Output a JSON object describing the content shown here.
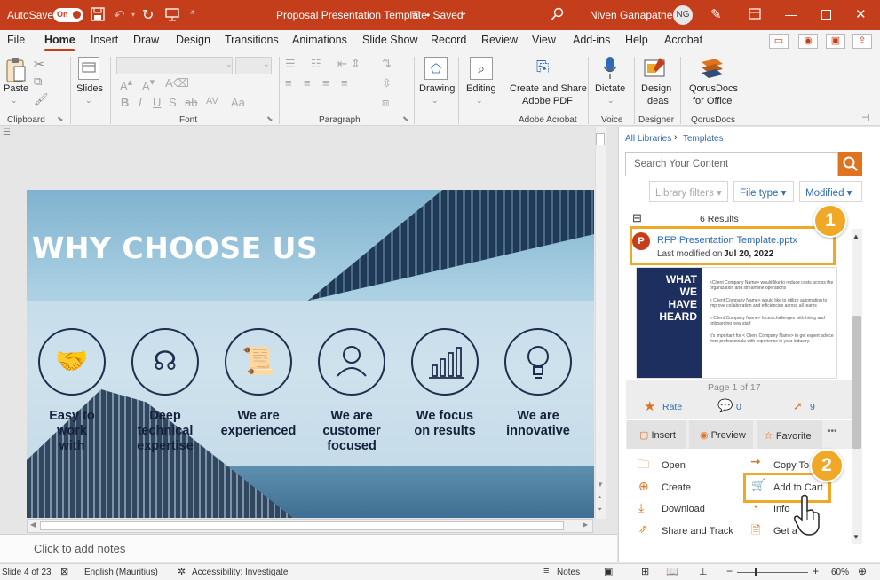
{
  "titlebar": {
    "autosave_label": "AutoSave",
    "autosave_state": "On",
    "document_title": "Proposal Presentation Template",
    "save_status": "• Saved",
    "user_name": "Niven Ganapathee",
    "user_initials": "NG"
  },
  "menu": {
    "tabs": [
      "File",
      "Home",
      "Insert",
      "Draw",
      "Design",
      "Transitions",
      "Animations",
      "Slide Show",
      "Record",
      "Review",
      "View",
      "Add-ins",
      "Help",
      "Acrobat"
    ],
    "active_tab": "Home"
  },
  "ribbon": {
    "paste_label": "Paste",
    "slides_label": "Slides",
    "drawing_label": "Drawing",
    "editing_label": "Editing",
    "create_pdf_line1": "Create and Share",
    "create_pdf_line2": "Adobe PDF",
    "dictate_label": "Dictate",
    "design_ideas_line1": "Design",
    "design_ideas_line2": "Ideas",
    "qorus_line1": "QorusDocs",
    "qorus_line2": "for Office",
    "groups": {
      "clipboard": "Clipboard",
      "font": "Font",
      "paragraph": "Paragraph",
      "adobe": "Adobe Acrobat",
      "voice": "Voice",
      "designer": "Designer",
      "qorus": "QorusDocs"
    }
  },
  "slide": {
    "title": "WHY CHOOSE US",
    "features": [
      {
        "icon": "handshake-icon",
        "line1": "Easy to",
        "line2": "work",
        "line3": "with"
      },
      {
        "icon": "brain-icon",
        "line1": "Deep",
        "line2": "technical",
        "line3": "expertise"
      },
      {
        "icon": "scroll-icon",
        "line1": "We are",
        "line2": "experienced",
        "line3": ""
      },
      {
        "icon": "person-icon",
        "line1": "We are",
        "line2": "customer",
        "line3": "focused"
      },
      {
        "icon": "bar-chart-icon",
        "line1": "We focus",
        "line2": "on results",
        "line3": ""
      },
      {
        "icon": "lightbulb-icon",
        "line1": "We are",
        "line2": "innovative",
        "line3": ""
      }
    ]
  },
  "notes_placeholder": "Click to add notes",
  "status": {
    "slide_info": "Slide 4 of 23",
    "language": "English (Mauritius)",
    "accessibility": "Accessibility: Investigate",
    "notes_label": "Notes",
    "zoom": "60%"
  },
  "pane": {
    "breadcrumb_root": "All Libraries",
    "breadcrumb_sep": "›",
    "breadcrumb_current": "Templates",
    "search_placeholder": "Search Your Content",
    "filters": [
      "Library filters",
      "File type",
      "Modified"
    ],
    "results_count": "6 Results",
    "result": {
      "file_name": "RFP Presentation Template.pptx",
      "modified_prefix": "Last modified on",
      "modified_date": "Jul 20, 2022"
    },
    "thumb_heading": [
      "WHAT",
      "WE",
      "HAVE",
      "HEARD"
    ],
    "thumb_bullets": [
      "<Client Company Name> would like to reduce costs across the organization and streamline operations",
      "< Client Company Name> would like to utilize automation to improve collaboration and efficiencies across all teams",
      "< Client Company Name> faces challenges with hiring and onboarding new staff",
      "It's important for < Client Company Name> to get expert advice from professionals with experience in your industry."
    ],
    "page_info": "Page 1 of 17",
    "rate_label": "Rate",
    "comments_count": "0",
    "clicks_count": "9",
    "actions": [
      "Insert",
      "Preview",
      "Favorite"
    ],
    "more_label": "•••",
    "menu_left": [
      "Open",
      "Create",
      "Download",
      "Share and Track"
    ],
    "menu_right": [
      "Copy To",
      "Add to Cart",
      "Info",
      "Get a"
    ],
    "callout_1": "1",
    "callout_2": "2"
  },
  "colors": {
    "accent": "#c43e1c",
    "qorus_orange": "#e07320",
    "callout": "#f0a926",
    "link": "#2f6bb3",
    "slide_text": "#1f2e4d"
  }
}
